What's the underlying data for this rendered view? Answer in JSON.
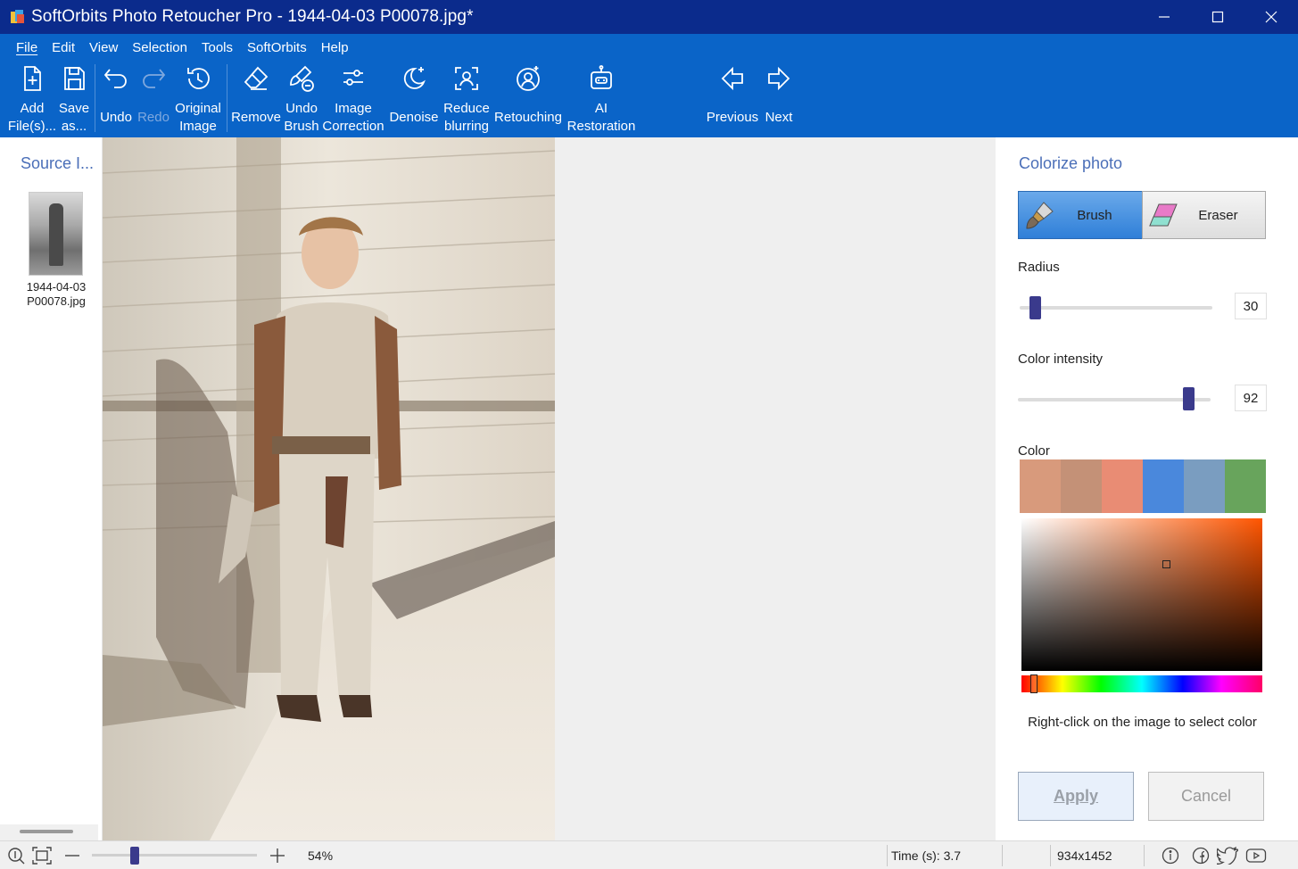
{
  "window": {
    "title": "SoftOrbits Photo Retoucher Pro - 1944-04-03 P00078.jpg*"
  },
  "menu": {
    "items": [
      {
        "label": "File",
        "key": "F"
      },
      {
        "label": "Edit",
        "key": "E"
      },
      {
        "label": "View",
        "key": "V"
      },
      {
        "label": "Selection",
        "key": "S"
      },
      {
        "label": "Tools",
        "key": "T"
      },
      {
        "label": "SoftOrbits",
        "key": ""
      },
      {
        "label": "Help",
        "key": "H"
      }
    ]
  },
  "toolbar": {
    "add_files": {
      "line1": "Add",
      "line2": "File(s)..."
    },
    "save_as": {
      "line1": "Save",
      "line2": "as..."
    },
    "undo": "Undo",
    "redo": "Redo",
    "original_image": {
      "line1": "Original",
      "line2": "Image"
    },
    "remove": "Remove",
    "undo_brush": {
      "line1": "Undo",
      "line2": "Brush"
    },
    "image_correction": {
      "line1": "Image",
      "line2": "Correction"
    },
    "denoise": "Denoise",
    "reduce_blurring": {
      "line1": "Reduce",
      "line2": "blurring"
    },
    "retouching": "Retouching",
    "ai_restoration": {
      "line1": "AI",
      "line2": "Restoration"
    },
    "previous": "Previous",
    "next": "Next"
  },
  "source_panel": {
    "title": "Source I...",
    "files": [
      {
        "name_line1": "1944-04-03",
        "name_line2": "P00078.jpg"
      }
    ]
  },
  "colorize": {
    "title": "Colorize photo",
    "brush_label": "Brush",
    "eraser_label": "Eraser",
    "active_tool": "brush",
    "radius_label": "Radius",
    "radius_value": "30",
    "radius_fraction": 0.08,
    "intensity_label": "Color intensity",
    "intensity_value": "92",
    "intensity_fraction": 0.89,
    "color_label": "Color",
    "swatches": [
      "#d89a7c",
      "#c49177",
      "#e98c74",
      "#4a88dc",
      "#7a9dc0",
      "#68a45c"
    ],
    "selected_color": "#c46a3a",
    "hint": "Right-click on the image to select color",
    "apply_label": "Apply",
    "cancel_label": "Cancel"
  },
  "status": {
    "zoom": "54%",
    "zoom_fraction": 0.24,
    "time": "Time (s): 3.7",
    "dimensions": "934x1452"
  },
  "colors": {
    "titlebar": "#0b2b8c",
    "toolbar": "#0a64c8",
    "accent_text": "#4b6fb8",
    "slider_thumb": "#3a3a8c"
  }
}
